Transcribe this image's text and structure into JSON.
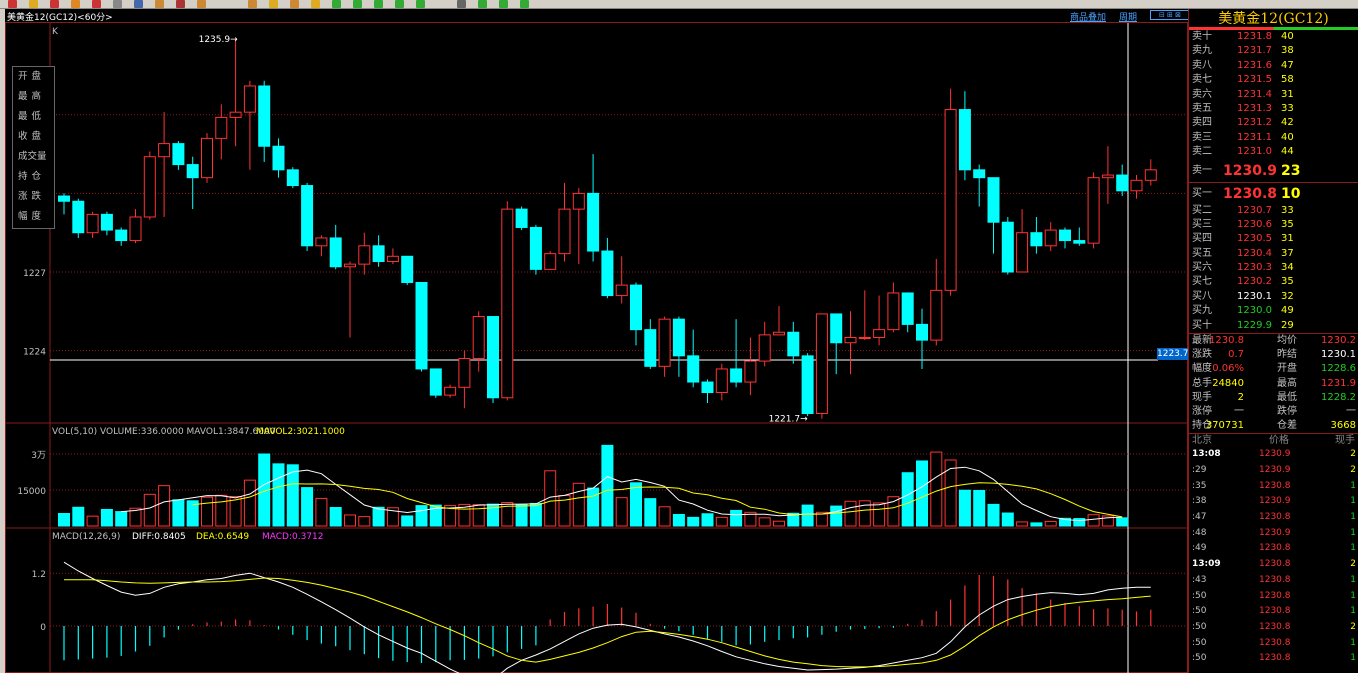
{
  "window": {
    "symbol_short": "美黄金12",
    "title_text": "美黄金12(GC12)<60分>",
    "chart_label": "K",
    "top_links": [
      "商品叠加",
      "周期"
    ],
    "current_price_tag": "1223.7"
  },
  "info_box": [
    "开盘",
    "最高",
    "最低",
    "收盘",
    "成交量",
    "持仓",
    "涨跌",
    "幅度"
  ],
  "price_axis": {
    "ticks": [
      "1227",
      "1224"
    ]
  },
  "annotations": {
    "high": "1235.9",
    "low": "1221.7"
  },
  "volume_panel": {
    "header_prefix": "VOL(5,10) VOLUME:336.0000 MAVOL1:3847.6000",
    "header_mavol2": "MAVOL2:3021.1000",
    "ticks": [
      "3万",
      "15000"
    ]
  },
  "macd_panel": {
    "header_prefix": "MACD(12,26,9)",
    "header_diff": "DIFF:0.8405",
    "header_dea": "DEA:0.6549",
    "header_macd": "MACD:0.3712",
    "ticks": [
      "1.2",
      "0"
    ]
  },
  "quote": {
    "title": "美黄金12(GC12)",
    "asks": [
      {
        "label": "卖十",
        "price": "1231.8",
        "vol": "40"
      },
      {
        "label": "卖九",
        "price": "1231.7",
        "vol": "38"
      },
      {
        "label": "卖八",
        "price": "1231.6",
        "vol": "47"
      },
      {
        "label": "卖七",
        "price": "1231.5",
        "vol": "58"
      },
      {
        "label": "卖六",
        "price": "1231.4",
        "vol": "31"
      },
      {
        "label": "卖五",
        "price": "1231.3",
        "vol": "33"
      },
      {
        "label": "卖四",
        "price": "1231.2",
        "vol": "42"
      },
      {
        "label": "卖三",
        "price": "1231.1",
        "vol": "40"
      },
      {
        "label": "卖二",
        "price": "1231.0",
        "vol": "44"
      }
    ],
    "ask1": {
      "label": "卖一",
      "price": "1230.9",
      "vol": "23"
    },
    "bid1": {
      "label": "买一",
      "price": "1230.8",
      "vol": "10"
    },
    "bids": [
      {
        "label": "买二",
        "price": "1230.7",
        "vol": "33",
        "color": "#ff3333"
      },
      {
        "label": "买三",
        "price": "1230.6",
        "vol": "35",
        "color": "#ff3333"
      },
      {
        "label": "买四",
        "price": "1230.5",
        "vol": "31",
        "color": "#ff3333"
      },
      {
        "label": "买五",
        "price": "1230.4",
        "vol": "37",
        "color": "#ff3333"
      },
      {
        "label": "买六",
        "price": "1230.3",
        "vol": "34",
        "color": "#ff3333"
      },
      {
        "label": "买七",
        "price": "1230.2",
        "vol": "35",
        "color": "#ff3333"
      },
      {
        "label": "买八",
        "price": "1230.1",
        "vol": "32",
        "color": "#ffffff"
      },
      {
        "label": "买九",
        "price": "1230.0",
        "vol": "49",
        "color": "#22cc22"
      },
      {
        "label": "买十",
        "price": "1229.9",
        "vol": "29",
        "color": "#22cc22"
      }
    ],
    "stats": [
      {
        "l1": "最新",
        "v1": "1230.8",
        "c1": "#ff3333",
        "l2": "均价",
        "v2": "1230.2",
        "c2": "#ff3333"
      },
      {
        "l1": "涨跌",
        "v1": "0.7",
        "c1": "#ff3333",
        "l2": "昨结",
        "v2": "1230.1",
        "c2": "#ffffff"
      },
      {
        "l1": "幅度",
        "v1": "0.06%",
        "c1": "#ff3333",
        "l2": "开盘",
        "v2": "1228.6",
        "c2": "#22cc22"
      },
      {
        "l1": "总手",
        "v1": "24840",
        "c1": "#ffff00",
        "l2": "最高",
        "v2": "1231.9",
        "c2": "#ff3333"
      },
      {
        "l1": "现手",
        "v1": "2",
        "c1": "#ffff00",
        "l2": "最低",
        "v2": "1228.2",
        "c2": "#22cc22"
      },
      {
        "l1": "涨停",
        "v1": "一",
        "c1": "#c0c0c0",
        "l2": "跌停",
        "v2": "一",
        "c2": "#c0c0c0"
      },
      {
        "l1": "持仓",
        "v1": "370731",
        "c1": "#ffff00",
        "l2": "仓差",
        "v2": "3668",
        "c2": "#ffff00"
      }
    ],
    "tick_header": [
      "北京",
      "价格",
      "现手"
    ],
    "ticks": [
      {
        "time": "13:08",
        "price": "1230.9",
        "vol": "2",
        "bold": true
      },
      {
        "time": ":29",
        "price": "1230.9",
        "vol": "2"
      },
      {
        "time": ":35",
        "price": "1230.8",
        "vol": "1"
      },
      {
        "time": ":38",
        "price": "1230.9",
        "vol": "1"
      },
      {
        "time": ":47",
        "price": "1230.8",
        "vol": "1"
      },
      {
        "time": ":48",
        "price": "1230.9",
        "vol": "1"
      },
      {
        "time": ":49",
        "price": "1230.8",
        "vol": "1"
      },
      {
        "time": "13:09",
        "price": "1230.8",
        "vol": "2",
        "bold": true
      },
      {
        "time": ":43",
        "price": "1230.8",
        "vol": "1"
      },
      {
        "time": ":50",
        "price": "1230.8",
        "vol": "1"
      },
      {
        "time": ":50",
        "price": "1230.8",
        "vol": "1"
      },
      {
        "time": ":50",
        "price": "1230.8",
        "vol": "2"
      },
      {
        "time": ":50",
        "price": "1230.8",
        "vol": "1"
      },
      {
        "time": ":50",
        "price": "1230.8",
        "vol": "1"
      }
    ]
  },
  "colors": {
    "up": "#ff3333",
    "down": "#00ffff",
    "grid": "#8b1a1a",
    "ma1": "#ffffff",
    "ma2": "#ffff00"
  },
  "chart_data": {
    "type": "candlestick",
    "candles": [
      [
        1229.9,
        1229.7,
        1230.0,
        1229.2
      ],
      [
        1229.7,
        1228.5,
        1229.8,
        1228.3
      ],
      [
        1228.5,
        1229.2,
        1229.3,
        1228.3
      ],
      [
        1229.2,
        1228.6,
        1229.3,
        1228.4
      ],
      [
        1228.6,
        1228.2,
        1228.7,
        1228.0
      ],
      [
        1228.2,
        1229.1,
        1229.4,
        1228.1
      ],
      [
        1229.1,
        1231.4,
        1231.6,
        1229.0
      ],
      [
        1231.4,
        1231.9,
        1233.1,
        1229.1
      ],
      [
        1231.9,
        1231.1,
        1232.0,
        1230.9
      ],
      [
        1231.1,
        1230.6,
        1231.4,
        1229.4
      ],
      [
        1230.6,
        1232.1,
        1232.3,
        1230.4
      ],
      [
        1232.1,
        1232.9,
        1233.4,
        1231.3
      ],
      [
        1232.9,
        1233.1,
        1235.9,
        1231.8
      ],
      [
        1233.1,
        1234.1,
        1234.3,
        1230.9
      ],
      [
        1234.1,
        1231.8,
        1234.3,
        1231.2
      ],
      [
        1231.8,
        1230.9,
        1232.1,
        1230.6
      ],
      [
        1230.9,
        1230.3,
        1231.0,
        1230.2
      ],
      [
        1230.3,
        1228.0,
        1230.4,
        1227.8
      ],
      [
        1228.0,
        1228.3,
        1228.4,
        1227.6
      ],
      [
        1228.3,
        1227.2,
        1228.8,
        1227.1
      ],
      [
        1227.2,
        1227.3,
        1227.4,
        1224.5
      ],
      [
        1227.3,
        1228.0,
        1228.5,
        1226.9
      ],
      [
        1228.0,
        1227.4,
        1228.4,
        1227.2
      ],
      [
        1227.4,
        1227.6,
        1227.9,
        1227.3
      ],
      [
        1227.6,
        1226.6,
        1227.6,
        1226.5
      ],
      [
        1226.6,
        1223.3,
        1226.6,
        1223.2
      ],
      [
        1223.3,
        1222.3,
        1223.3,
        1222.2
      ],
      [
        1222.3,
        1222.6,
        1222.7,
        1222.2
      ],
      [
        1222.6,
        1223.7,
        1224.0,
        1221.8
      ],
      [
        1223.7,
        1225.3,
        1225.5,
        1223.2
      ],
      [
        1225.3,
        1222.2,
        1225.3,
        1222.0
      ],
      [
        1222.2,
        1229.4,
        1229.7,
        1222.1
      ],
      [
        1229.4,
        1228.7,
        1229.5,
        1228.6
      ],
      [
        1228.7,
        1227.1,
        1228.8,
        1226.9
      ],
      [
        1227.1,
        1227.7,
        1227.8,
        1227.3
      ],
      [
        1227.7,
        1229.4,
        1230.4,
        1227.4
      ],
      [
        1229.4,
        1230.0,
        1230.2,
        1227.3
      ],
      [
        1230.0,
        1227.8,
        1231.5,
        1227.4
      ],
      [
        1227.8,
        1226.1,
        1228.3,
        1226.0
      ],
      [
        1226.1,
        1226.5,
        1227.6,
        1225.8
      ],
      [
        1226.5,
        1224.8,
        1226.6,
        1224.2
      ],
      [
        1224.8,
        1223.4,
        1225.2,
        1223.3
      ],
      [
        1223.4,
        1225.2,
        1225.3,
        1223.0
      ],
      [
        1225.2,
        1223.8,
        1225.3,
        1223.0
      ],
      [
        1223.8,
        1222.8,
        1224.8,
        1222.6
      ],
      [
        1222.8,
        1222.4,
        1222.9,
        1222.0
      ],
      [
        1222.4,
        1223.3,
        1223.5,
        1222.1
      ],
      [
        1223.3,
        1222.8,
        1225.2,
        1222.6
      ],
      [
        1222.8,
        1223.6,
        1224.5,
        1222.3
      ],
      [
        1223.6,
        1224.6,
        1225.1,
        1223.4
      ],
      [
        1224.6,
        1224.7,
        1225.7,
        1224.6
      ],
      [
        1224.7,
        1223.8,
        1225.1,
        1223.5
      ],
      [
        1223.8,
        1221.6,
        1223.9,
        1221.5
      ],
      [
        1221.6,
        1225.4,
        1225.4,
        1221.4
      ],
      [
        1225.4,
        1224.3,
        1224.9,
        1223.1
      ],
      [
        1224.3,
        1224.5,
        1225.5,
        1223.1
      ],
      [
        1224.5,
        1224.5,
        1226.3,
        1224.4
      ],
      [
        1224.5,
        1224.8,
        1226.1,
        1224.2
      ],
      [
        1224.8,
        1226.2,
        1226.6,
        1224.7
      ],
      [
        1226.2,
        1225.0,
        1226.2,
        1224.7
      ],
      [
        1225.0,
        1224.4,
        1225.6,
        1223.3
      ],
      [
        1224.4,
        1226.3,
        1227.5,
        1224.2
      ],
      [
        1226.3,
        1233.2,
        1234.0,
        1226.1
      ],
      [
        1233.2,
        1230.9,
        1233.9,
        1230.5
      ],
      [
        1230.9,
        1230.6,
        1231.1,
        1229.5
      ],
      [
        1230.6,
        1228.9,
        1230.6,
        1227.7
      ],
      [
        1228.9,
        1227.0,
        1229.1,
        1226.9
      ],
      [
        1227.0,
        1228.5,
        1229.4,
        1227.1
      ],
      [
        1228.5,
        1228.0,
        1229.1,
        1227.7
      ],
      [
        1228.0,
        1228.6,
        1228.9,
        1227.8
      ],
      [
        1228.6,
        1228.2,
        1228.7,
        1227.9
      ],
      [
        1228.2,
        1228.1,
        1228.7,
        1228.0
      ],
      [
        1228.1,
        1230.6,
        1230.8,
        1227.9
      ],
      [
        1230.6,
        1230.7,
        1231.8,
        1229.6
      ],
      [
        1230.7,
        1230.1,
        1231.1,
        1229.9
      ],
      [
        1230.1,
        1230.5,
        1230.7,
        1229.8
      ],
      [
        1230.5,
        1230.9,
        1231.3,
        1230.3
      ]
    ],
    "volume": [
      5200,
      7800,
      4100,
      6900,
      6000,
      7400,
      13200,
      16800,
      10900,
      10500,
      12000,
      12800,
      12300,
      19100,
      30000,
      25900,
      25500,
      16000,
      11500,
      7700,
      4600,
      3900,
      7800,
      7600,
      4200,
      8500,
      8700,
      8500,
      9000,
      8900,
      9100,
      9800,
      8900,
      9400,
      23000,
      12700,
      17800,
      15800,
      33600,
      11800,
      18000,
      11400,
      8000,
      4800,
      3600,
      5100,
      3600,
      6500,
      5700,
      3400,
      2000,
      5300,
      8700,
      5700,
      8300,
      10300,
      10500,
      9600,
      12200,
      22200,
      27100,
      30800,
      27500,
      14900,
      14800,
      9000,
      5400,
      1700,
      1300,
      1900,
      3200,
      3100,
      4700,
      4200,
      3400
    ],
    "macd": {
      "ylim": [
        -1.5,
        1.6
      ],
      "diff": [
        1.45,
        1.25,
        1.08,
        0.92,
        0.77,
        0.7,
        0.74,
        0.88,
        0.96,
        1.0,
        1.05,
        1.08,
        1.15,
        1.2,
        1.1,
        1.0,
        0.88,
        0.72,
        0.55,
        0.37,
        0.18,
        -0.02,
        -0.2,
        -0.35,
        -0.5,
        -0.62,
        -0.8,
        -0.98,
        -1.13,
        -1.18,
        -1.22,
        -0.96,
        -0.78,
        -0.66,
        -0.52,
        -0.35,
        -0.18,
        -0.05,
        0.02,
        0.04,
        -0.02,
        -0.1,
        -0.18,
        -0.25,
        -0.34,
        -0.45,
        -0.58,
        -0.7,
        -0.78,
        -0.86,
        -0.92,
        -0.96,
        -1.0,
        -0.99,
        -0.98,
        -0.96,
        -0.94,
        -0.9,
        -0.84,
        -0.78,
        -0.72,
        -0.62,
        -0.36,
        -0.02,
        0.25,
        0.45,
        0.6,
        0.67,
        0.72,
        0.76,
        0.74,
        0.71,
        0.74,
        0.82,
        0.86,
        0.88,
        0.88
      ],
      "dea": [
        1.05,
        1.05,
        1.05,
        1.03,
        1.0,
        0.98,
        0.97,
        0.98,
        0.99,
        1.0,
        1.0,
        1.01,
        1.03,
        1.06,
        1.09,
        1.08,
        1.04,
        0.99,
        0.93,
        0.85,
        0.77,
        0.68,
        0.56,
        0.44,
        0.32,
        0.19,
        0.05,
        -0.08,
        -0.22,
        -0.38,
        -0.52,
        -0.68,
        -0.78,
        -0.82,
        -0.76,
        -0.68,
        -0.6,
        -0.5,
        -0.38,
        -0.24,
        -0.14,
        -0.12,
        -0.15,
        -0.19,
        -0.24,
        -0.3,
        -0.38,
        -0.48,
        -0.58,
        -0.68,
        -0.76,
        -0.82,
        -0.86,
        -0.9,
        -0.92,
        -0.93,
        -0.93,
        -0.92,
        -0.9,
        -0.87,
        -0.84,
        -0.78,
        -0.66,
        -0.46,
        -0.22,
        -0.02,
        0.14,
        0.26,
        0.36,
        0.44,
        0.5,
        0.54,
        0.57,
        0.6,
        0.62,
        0.65,
        0.68
      ],
      "hist": [
        -0.78,
        -0.76,
        -0.74,
        -0.72,
        -0.68,
        -0.58,
        -0.45,
        -0.26,
        -0.08,
        0.04,
        0.08,
        0.1,
        0.15,
        0.13,
        0.02,
        -0.08,
        -0.2,
        -0.32,
        -0.4,
        -0.46,
        -0.55,
        -0.64,
        -0.73,
        -0.79,
        -0.82,
        -0.84,
        -0.82,
        -0.78,
        -0.77,
        -0.74,
        -0.69,
        -0.6,
        -0.52,
        -0.44,
        0.15,
        0.32,
        0.4,
        0.44,
        0.5,
        0.42,
        0.3,
        0.05,
        -0.06,
        -0.12,
        -0.2,
        -0.3,
        -0.36,
        -0.44,
        -0.42,
        -0.36,
        -0.32,
        -0.28,
        -0.26,
        -0.2,
        -0.13,
        -0.08,
        -0.07,
        -0.05,
        -0.04,
        0.05,
        0.14,
        0.34,
        0.6,
        0.92,
        1.16,
        1.14,
        1.06,
        0.86,
        0.74,
        0.6,
        0.52,
        0.45,
        0.38,
        0.4,
        0.37,
        0.33,
        0.37
      ]
    }
  }
}
